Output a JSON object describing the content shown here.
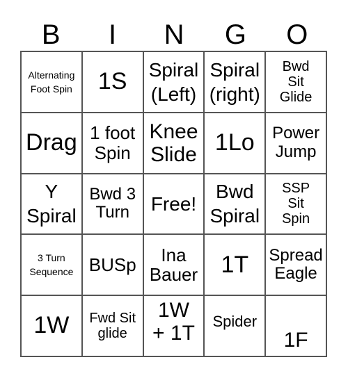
{
  "header": [
    "B",
    "I",
    "N",
    "G",
    "O"
  ],
  "cells": [
    "Alternating\nFoot Spin",
    "1S",
    "Spiral\n(Left)",
    "Spiral\n(right)",
    "Bwd\nSit\nGlide",
    "Drag",
    "1 foot\nSpin",
    "Knee\nSlide",
    "1Lo",
    "Power\nJump",
    "Y\nSpiral",
    "Bwd 3\nTurn",
    "Free!",
    "Bwd\nSpiral",
    "SSP\nSit\nSpin",
    "3 Turn\nSequence",
    "BUSp",
    "Ina\nBauer",
    "1T",
    "Spread\nEagle",
    "1W",
    "Fwd Sit\nglide",
    "1W\n+ 1T",
    "Spider",
    "1F"
  ]
}
